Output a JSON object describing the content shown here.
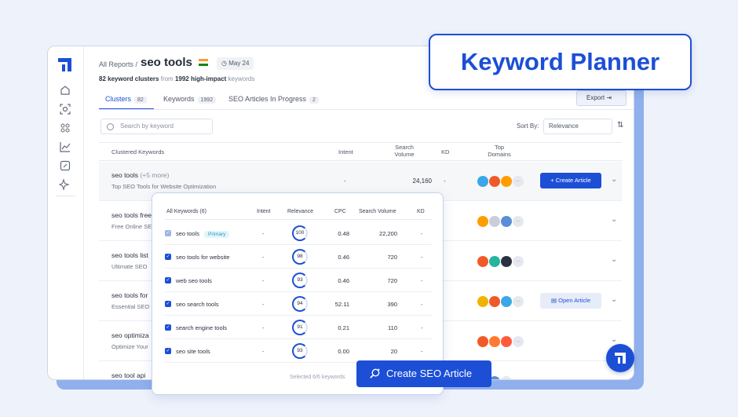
{
  "badge": {
    "title": "Keyword Planner"
  },
  "header": {
    "breadcrumb": "All Reports /",
    "title": "seo tools",
    "date": "May 24",
    "clusters_count": "82 keyword clusters",
    "from_text": "from",
    "keywords_count": "1992 high-impact",
    "keywords_suffix": "keywords"
  },
  "tabs": [
    {
      "label": "Clusters",
      "count": "82"
    },
    {
      "label": "Keywords",
      "count": "1992"
    },
    {
      "label": "SEO Articles In Progress",
      "count": "2"
    }
  ],
  "toolbar": {
    "export_label": "Export",
    "search_placeholder": "Search by keyword",
    "sort_label": "Sort By:",
    "sort_value": "Relevance"
  },
  "table": {
    "headers": {
      "clustered": "Clustered Keywords",
      "intent": "Intent",
      "search_volume_1": "Search",
      "search_volume_2": "Volume",
      "kd": "KD",
      "top_domains_1": "Top",
      "top_domains_2": "Domains"
    },
    "rows": [
      {
        "keyword": "seo tools",
        "more": "(+5 more)",
        "subtitle": "Top SEO Tools for Website Optimization",
        "intent": "-",
        "volume": "24,160",
        "kd": "-",
        "action": "+ Create Article"
      },
      {
        "keyword": "seo tools free",
        "subtitle": "Free Online SEO"
      },
      {
        "keyword": "seo tools list",
        "subtitle": "Ultimate SEO"
      },
      {
        "keyword": "seo tools for",
        "subtitle": "Essential SEO",
        "action": "Open Article"
      },
      {
        "keyword": "seo optimiza",
        "subtitle": "Optimize Your"
      },
      {
        "keyword": "seo tool api",
        "subtitle": ""
      }
    ]
  },
  "overlay": {
    "headers": {
      "all_keywords": "All Keywords (6)",
      "intent": "Intent",
      "relevance": "Relevance",
      "cpc": "CPC",
      "search_volume": "Search Volume",
      "kd": "KD"
    },
    "rows": [
      {
        "keyword": "seo tools",
        "badge": "Primary",
        "intent": "-",
        "relevance": "100",
        "cpc": "0.48",
        "volume": "22,200",
        "kd": "-"
      },
      {
        "keyword": "seo tools for website",
        "intent": "-",
        "relevance": "98",
        "cpc": "0.46",
        "volume": "720",
        "kd": "-"
      },
      {
        "keyword": "web seo tools",
        "intent": "-",
        "relevance": "93",
        "cpc": "0.46",
        "volume": "720",
        "kd": "-"
      },
      {
        "keyword": "seo search tools",
        "intent": "-",
        "relevance": "94",
        "cpc": "52.11",
        "volume": "390",
        "kd": "-"
      },
      {
        "keyword": "search engine tools",
        "intent": "-",
        "relevance": "91",
        "cpc": "0.21",
        "volume": "110",
        "kd": "-"
      },
      {
        "keyword": "seo site tools",
        "intent": "-",
        "relevance": "93",
        "cpc": "0.00",
        "volume": "20",
        "kd": "-"
      }
    ],
    "footer": "Selected 6/6 keywords"
  },
  "cta": {
    "label": "Create SEO Article"
  },
  "colors": {
    "accent": "#1c4fd6",
    "background": "#eef2fb"
  },
  "icons": {
    "sidebar": [
      "home-icon",
      "scan-icon",
      "grid-icon",
      "chart-icon",
      "edit-icon",
      "sparkle-icon"
    ]
  }
}
